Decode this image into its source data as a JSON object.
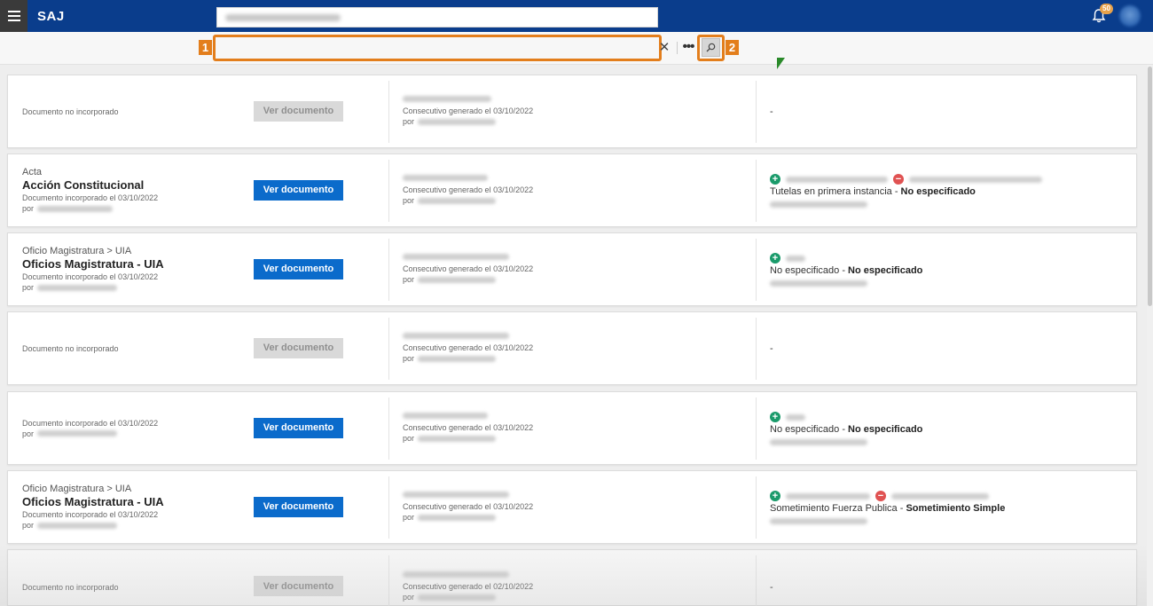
{
  "app": {
    "title": "SAJ",
    "notification_count": "50"
  },
  "search": {
    "placeholder": "",
    "clear_symbol": "✕",
    "more_symbol": "•••",
    "label_1": "1",
    "label_2": "2"
  },
  "cards": [
    {
      "category": "",
      "title": "",
      "doc_status": "Documento no incorporado",
      "button": "Ver documento",
      "button_enabled": false,
      "consecutivo": "Consecutivo generado el 03/10/2022",
      "por": "por",
      "dash": "-",
      "tipo": "",
      "tipo_bold": ""
    },
    {
      "category": "Acta",
      "title": "Acción Constitucional",
      "doc_status": "Documento incorporado el 03/10/2022",
      "button": "Ver documento",
      "button_enabled": true,
      "consecutivo": "Consecutivo generado el 03/10/2022",
      "por": "por",
      "dash": "",
      "tipo": "Tutelas en primera instancia - ",
      "tipo_bold": "No especificado"
    },
    {
      "category": "Oficio Magistratura > UIA",
      "title": "Oficios Magistratura - UIA",
      "doc_status": "Documento incorporado el 03/10/2022",
      "button": "Ver documento",
      "button_enabled": true,
      "consecutivo": "Consecutivo generado el 03/10/2022",
      "por": "por",
      "dash": "",
      "tipo": "No especificado - ",
      "tipo_bold": "No especificado"
    },
    {
      "category": "",
      "title": "",
      "doc_status": "Documento no incorporado",
      "button": "Ver documento",
      "button_enabled": false,
      "consecutivo": "Consecutivo generado el 03/10/2022",
      "por": "por",
      "dash": "-",
      "tipo": "",
      "tipo_bold": ""
    },
    {
      "category": "",
      "title": "",
      "doc_status": "Documento incorporado el 03/10/2022",
      "button": "Ver documento",
      "button_enabled": true,
      "consecutivo": "Consecutivo generado el 03/10/2022",
      "por": "por",
      "dash": "",
      "tipo": "No especificado - ",
      "tipo_bold": "No especificado"
    },
    {
      "category": "Oficio Magistratura > UIA",
      "title": "Oficios Magistratura - UIA",
      "doc_status": "Documento incorporado el 03/10/2022",
      "button": "Ver documento",
      "button_enabled": true,
      "consecutivo": "Consecutivo generado el 03/10/2022",
      "por": "por",
      "dash": "",
      "tipo": "Sometimiento Fuerza Publica - ",
      "tipo_bold": "Sometimiento Simple"
    },
    {
      "category": "",
      "title": "",
      "doc_status": "Documento no incorporado",
      "button": "Ver documento",
      "button_enabled": false,
      "consecutivo": "Consecutivo generado el 02/10/2022",
      "por": "por",
      "dash": "-",
      "tipo": "",
      "tipo_bold": ""
    }
  ],
  "colors": {
    "topbar": "#0a3d8c",
    "primary_button": "#0b6bcb",
    "highlight": "#e37e1c",
    "plus_icon": "#1a9b6b",
    "minus_icon": "#e05252"
  },
  "icons": {
    "menu": "menu-icon",
    "bell": "bell-icon",
    "search": "search-icon",
    "clear": "close-icon",
    "more": "more-icon",
    "plus": "plus-circle-icon",
    "minus": "minus-circle-icon"
  }
}
